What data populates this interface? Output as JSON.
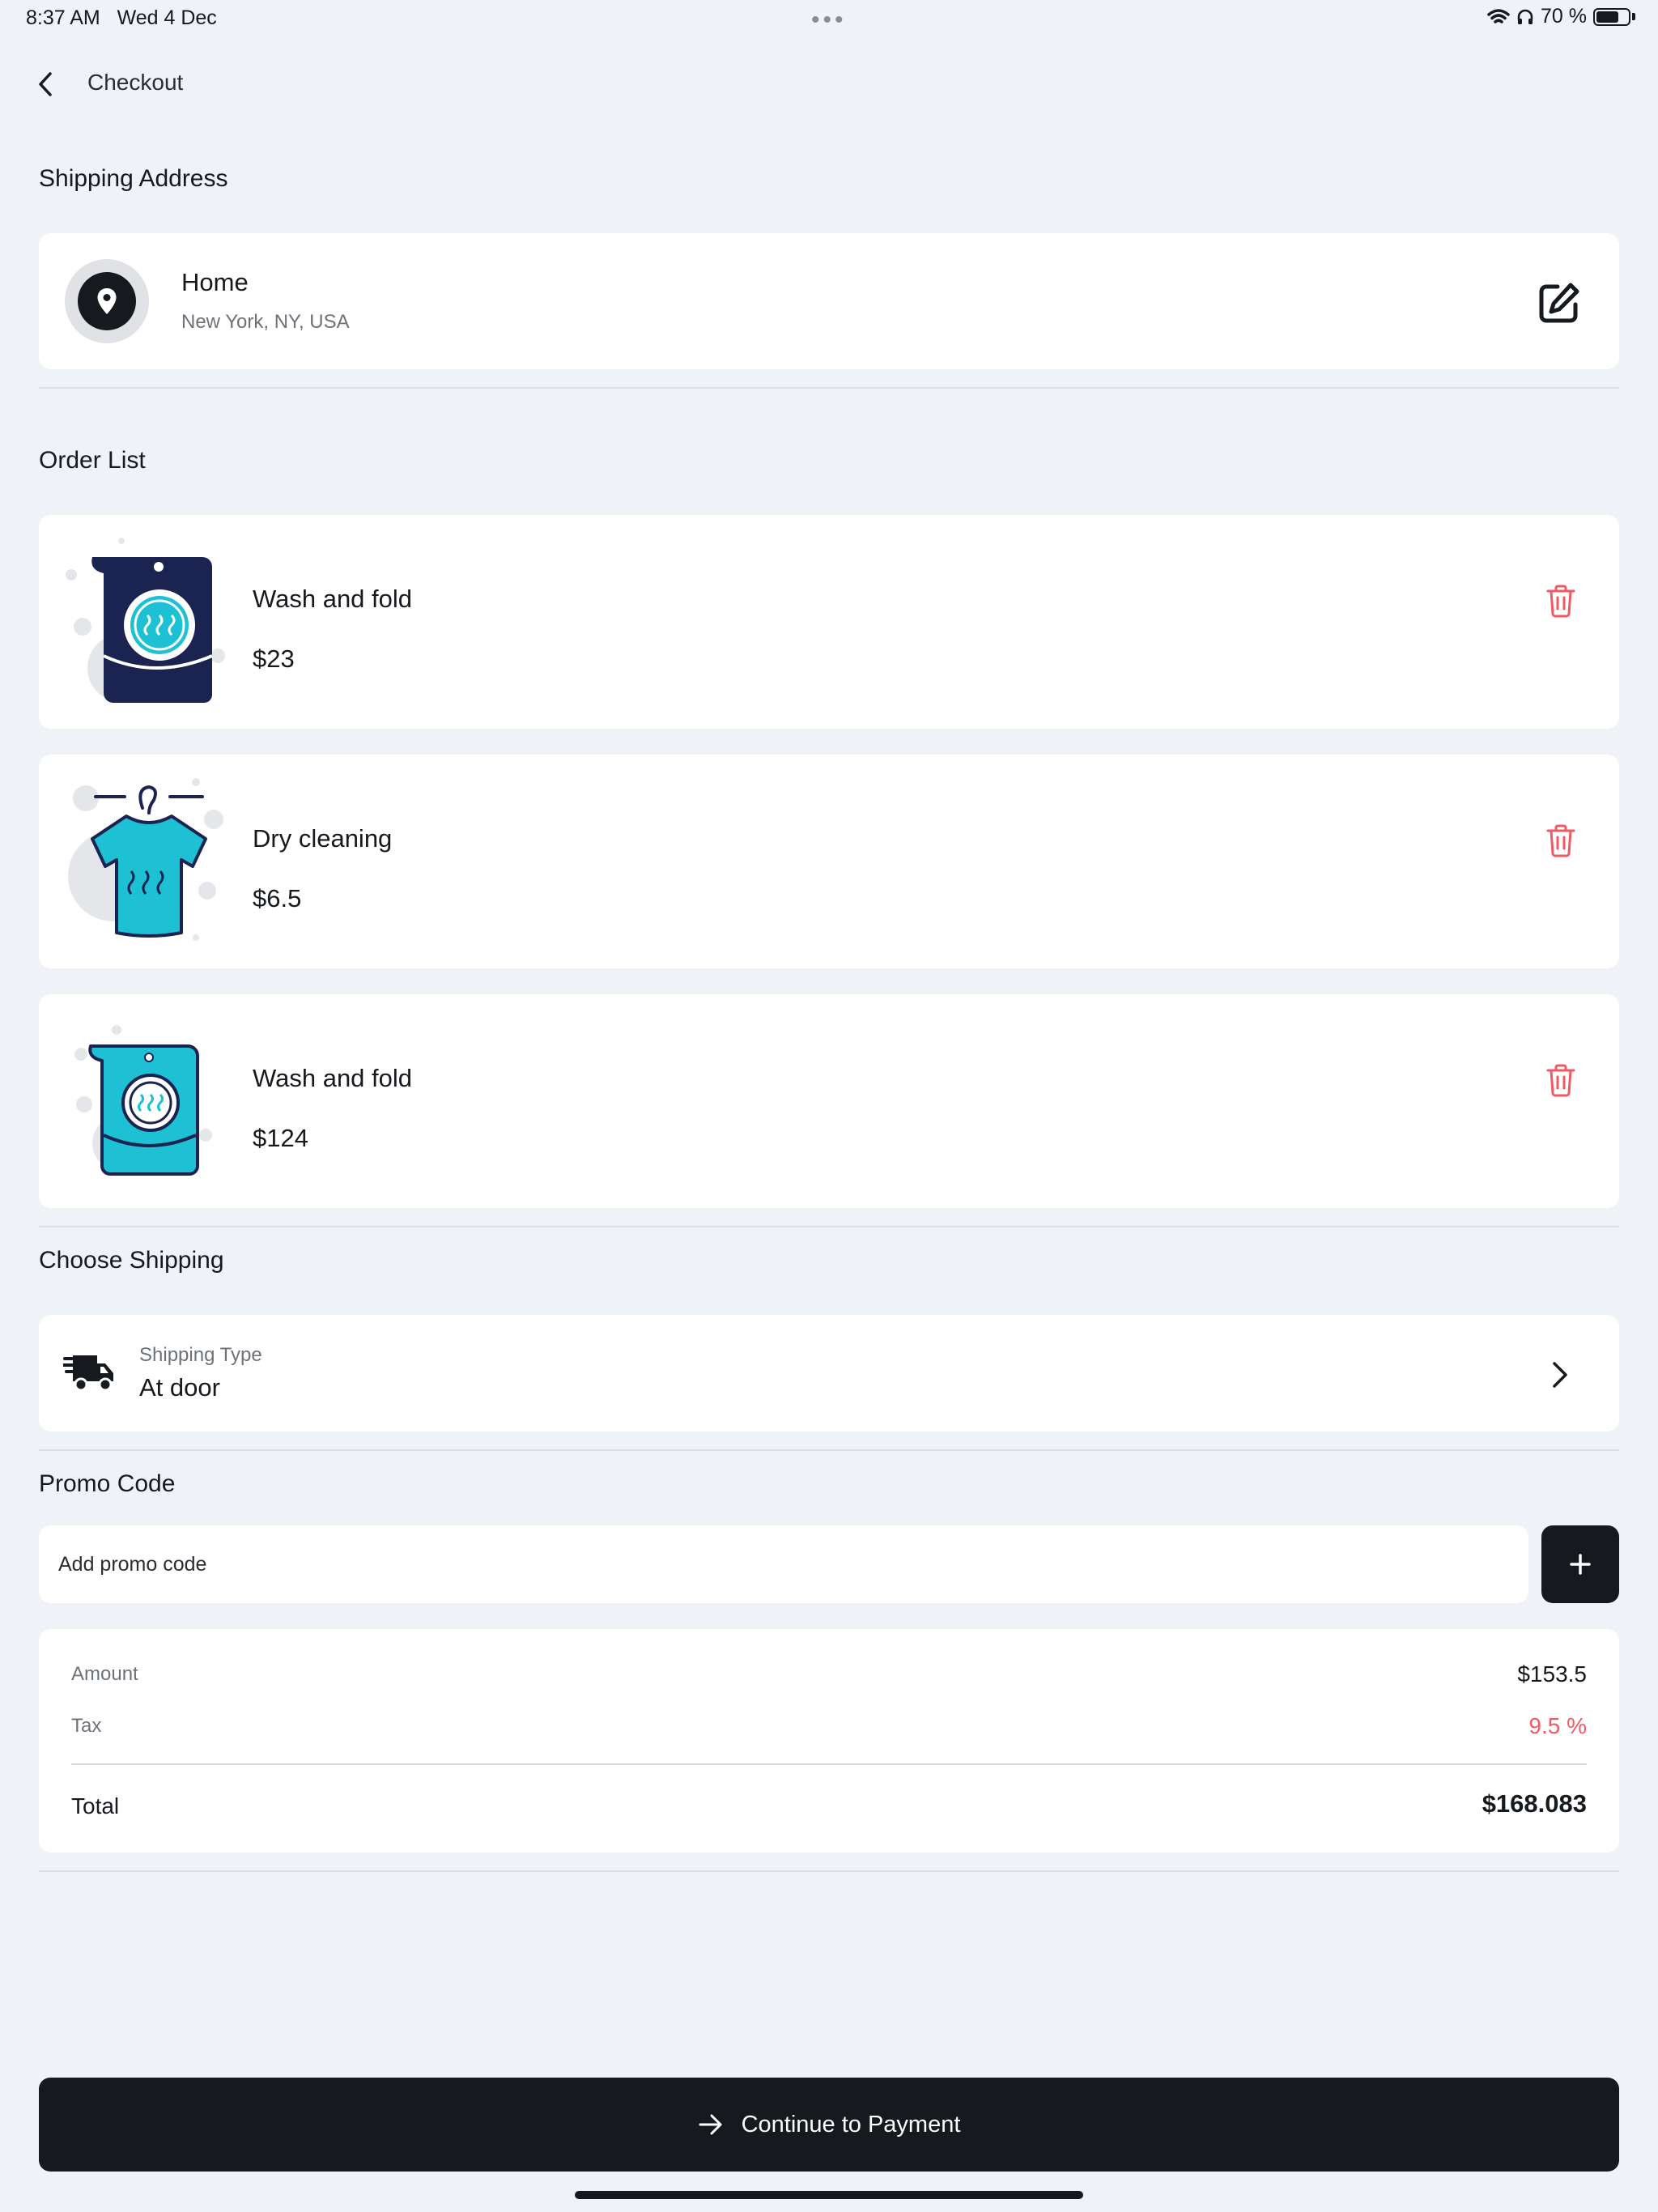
{
  "status_bar": {
    "time": "8:37 AM",
    "date": "Wed 4 Dec",
    "battery": "70 %",
    "battery_level": 0.7
  },
  "header": {
    "title": "Checkout",
    "back_icon": "chevron-left-icon"
  },
  "shipping_address": {
    "section_title": "Shipping Address",
    "name": "Home",
    "address": "New York, NY, USA",
    "pin_icon": "location-pin-icon",
    "edit_icon": "edit-icon"
  },
  "order_list": {
    "section_title": "Order List",
    "items": [
      {
        "title": "Wash and fold",
        "price": "$23",
        "image": "laundry-bag-navy-icon"
      },
      {
        "title": "Dry cleaning",
        "price": "$6.5",
        "image": "shirt-hanger-icon"
      },
      {
        "title": "Wash and fold",
        "price": "$124",
        "image": "laundry-bag-teal-icon"
      }
    ],
    "delete_icon": "trash-icon"
  },
  "choose_shipping": {
    "section_title": "Choose Shipping",
    "label": "Shipping Type",
    "value": "At door",
    "truck_icon": "delivery-truck-icon"
  },
  "promo": {
    "section_title": "Promo Code",
    "placeholder": "Add promo code",
    "value": ""
  },
  "summary": {
    "amount_label": "Amount",
    "amount": "$153.5",
    "tax_label": "Tax",
    "tax": "9.5 %",
    "total_label": "Total",
    "total": "$168.083"
  },
  "footer": {
    "button_label": "Continue to Payment"
  },
  "colors": {
    "background": "#eff2f7",
    "dark": "#16191d",
    "danger": "#ef5a64",
    "teal": "#1ec0d4",
    "navy": "#1b2350"
  }
}
